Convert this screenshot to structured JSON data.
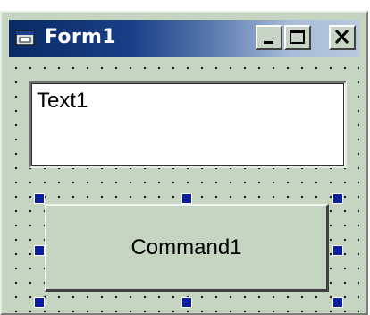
{
  "window": {
    "title": "Form1"
  },
  "titlebar_buttons": {
    "minimize_icon": "minimize-icon",
    "maximize_icon": "maximize-icon",
    "close_icon": "close-icon"
  },
  "form": {
    "textbox_value": "Text1",
    "command_caption": "Command1",
    "selected_control": "Command1"
  },
  "colors": {
    "titlebar_start": "#0a2a66",
    "titlebar_end": "#b8c8de",
    "form_background": "#c6d4c2",
    "selection_handle": "#0b1ea0"
  }
}
